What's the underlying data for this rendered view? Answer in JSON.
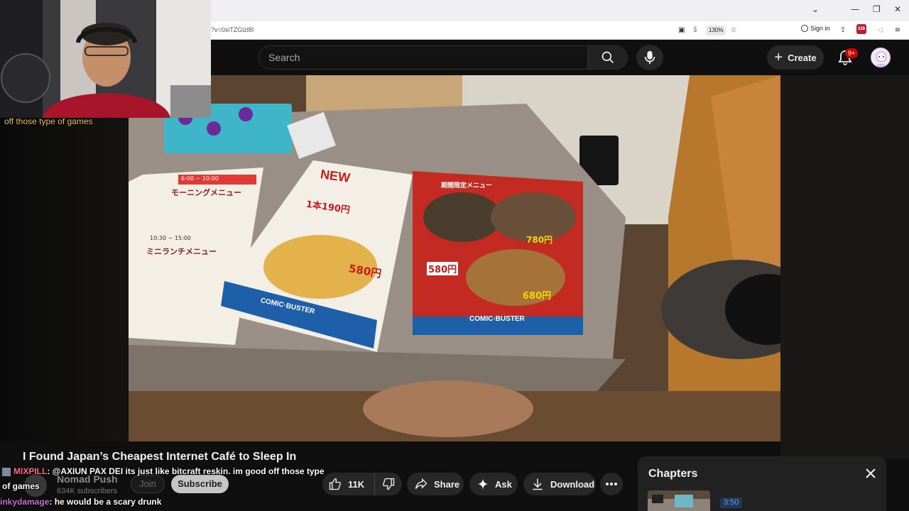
{
  "browser": {
    "url_fragment": "?v=0xiTZGlzl8I",
    "zoom": "130%",
    "sign_in_label": "Sign in",
    "extension_badge": "328"
  },
  "header": {
    "search_placeholder": "Search",
    "create_label": "Create",
    "notification_count": "9+"
  },
  "webcam": {
    "caption": "off those type of games"
  },
  "video": {
    "title": "I Found Japan’s Cheapest Internet Café to Sleep In",
    "channel": "Nomad Push",
    "subscribers": "634K subscribers",
    "join_label": "Join",
    "subscribe_label": "Subscribe",
    "likes": "11K",
    "share_label": "Share",
    "ask_label": "Ask",
    "download_label": "Download"
  },
  "chat": [
    {
      "user": "MIXPILL",
      "message": ": @AXIUN PAX DEI its just like bitcraft reskin. im good off those type",
      "continuation": "of games"
    },
    {
      "user": "inkydamage",
      "message": ": he would be a scary drunk"
    }
  ],
  "scene_text": {
    "badge_new": "NEW",
    "price_1": "1本190円",
    "price_2": "580円",
    "price_3": "580円",
    "price_4": "780円",
    "price_5": "680円",
    "brand_1": "COMIC·BUSTER",
    "brand_2": "COMIC·BUSTER",
    "menu_header": "期間限定メニュー",
    "left_menu_time_1": "6:00 ~ 10:00",
    "left_menu_title_1": "モーニングメニュー",
    "left_menu_time_2": "10:30 ~ 15:00",
    "left_menu_title_2": "ミニランチメニュー"
  },
  "chapters": {
    "title": "Chapters",
    "first_time": "3:50"
  },
  "colors": {
    "yt_bg": "#0f0f0f",
    "pill_bg": "#272727",
    "notif_red": "#cc0000",
    "caption_yellow": "#e8c545"
  }
}
